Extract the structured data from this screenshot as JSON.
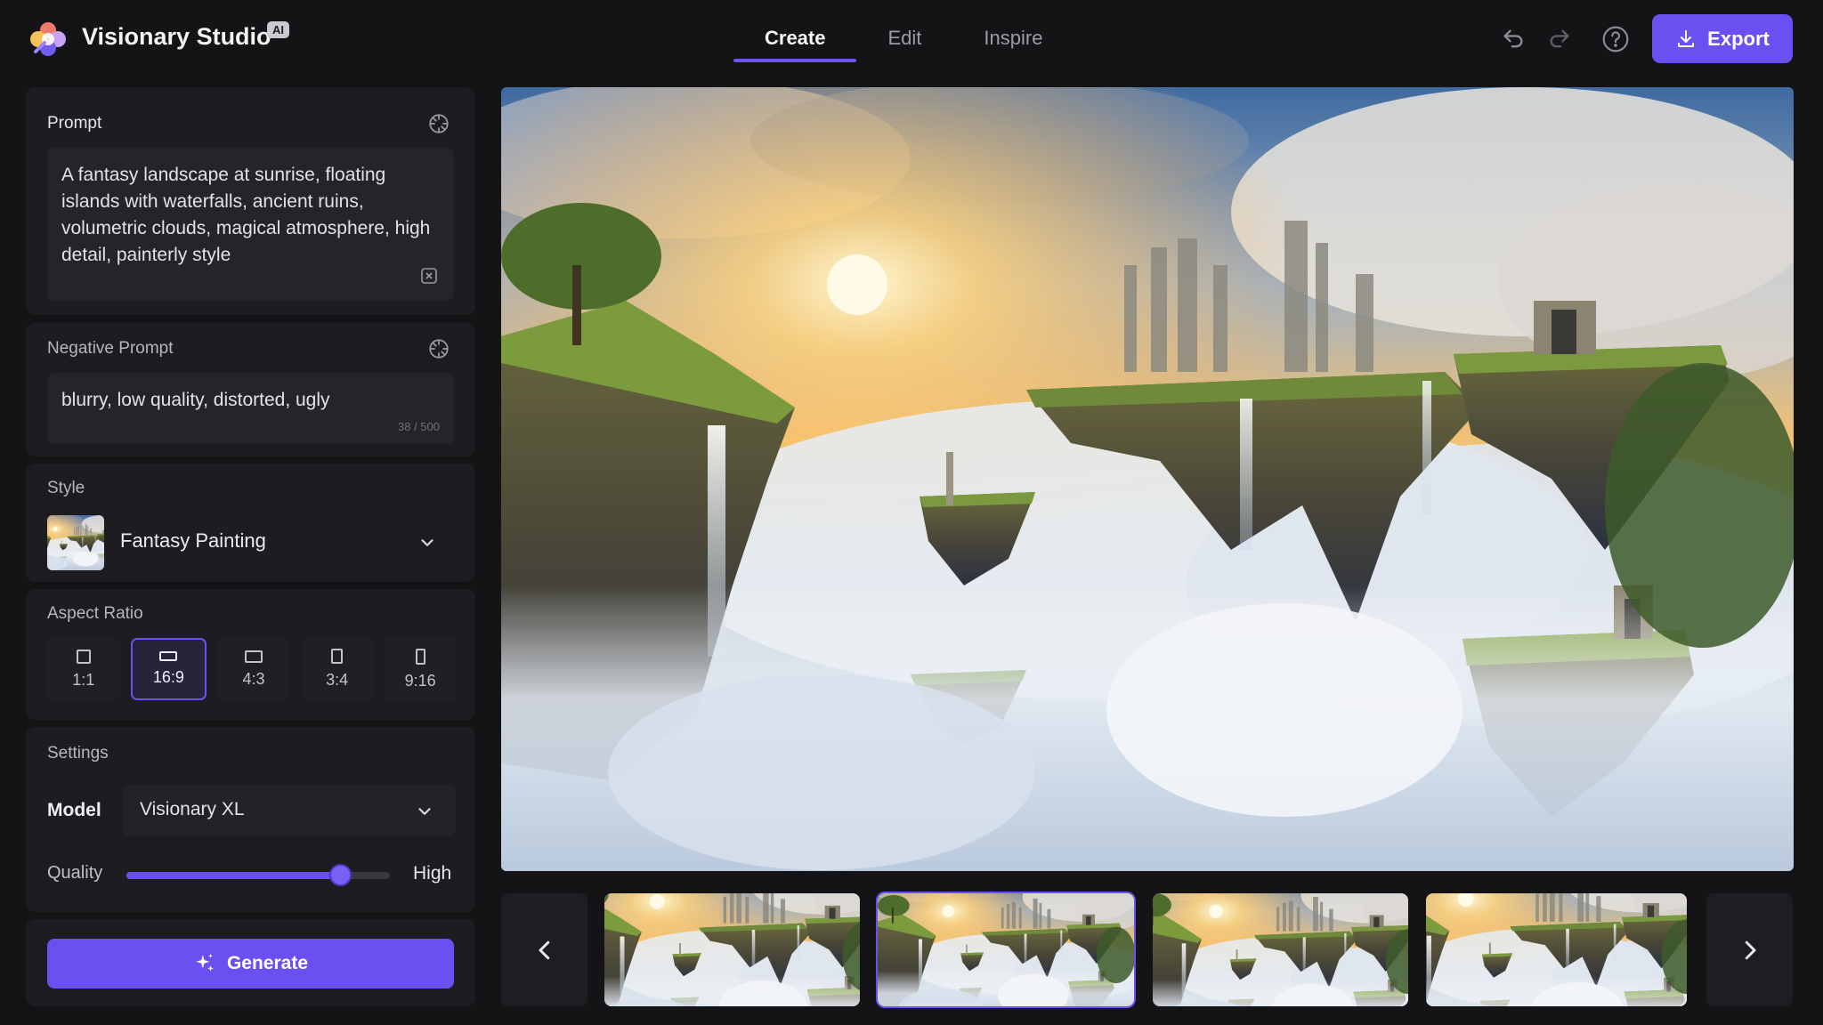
{
  "app": {
    "name": "Visionary Studio",
    "badge": "AI"
  },
  "tabs": [
    {
      "label": "Create",
      "active": true
    },
    {
      "label": "Edit",
      "active": false
    },
    {
      "label": "Inspire",
      "active": false
    }
  ],
  "toolbar": {
    "undo_icon": "undo-icon",
    "redo_icon": "redo-icon",
    "help_icon": "help-icon",
    "export_label": "Export"
  },
  "prompt": {
    "label": "Prompt",
    "text": "A fantasy landscape at sunrise, floating islands with waterfalls, ancient ruins, volumetric clouds, magical atmosphere, high detail, painterly style"
  },
  "negative_prompt": {
    "label": "Negative Prompt",
    "text": "blurry, low quality, distorted, ugly",
    "char_count": "38 / 500"
  },
  "style": {
    "label": "Style",
    "value": "Fantasy Painting"
  },
  "aspect_ratio": {
    "label": "Aspect Ratio",
    "options": [
      {
        "label": "1:1",
        "active": false
      },
      {
        "label": "16:9",
        "active": true
      },
      {
        "label": "4:3",
        "active": false
      },
      {
        "label": "3:4",
        "active": false
      },
      {
        "label": "9:16",
        "active": false
      }
    ]
  },
  "settings": {
    "label": "Settings",
    "model_label": "Model",
    "model_value": "Visionary XL",
    "quality_label": "Quality",
    "quality_value": "High",
    "quality_level": 0.81
  },
  "generate": {
    "label": "Generate"
  },
  "gallery": {
    "selected_index": 1,
    "count": 4
  },
  "colors": {
    "accent": "#6b4ff0",
    "panel": "#1d1d21",
    "background": "#141416"
  }
}
